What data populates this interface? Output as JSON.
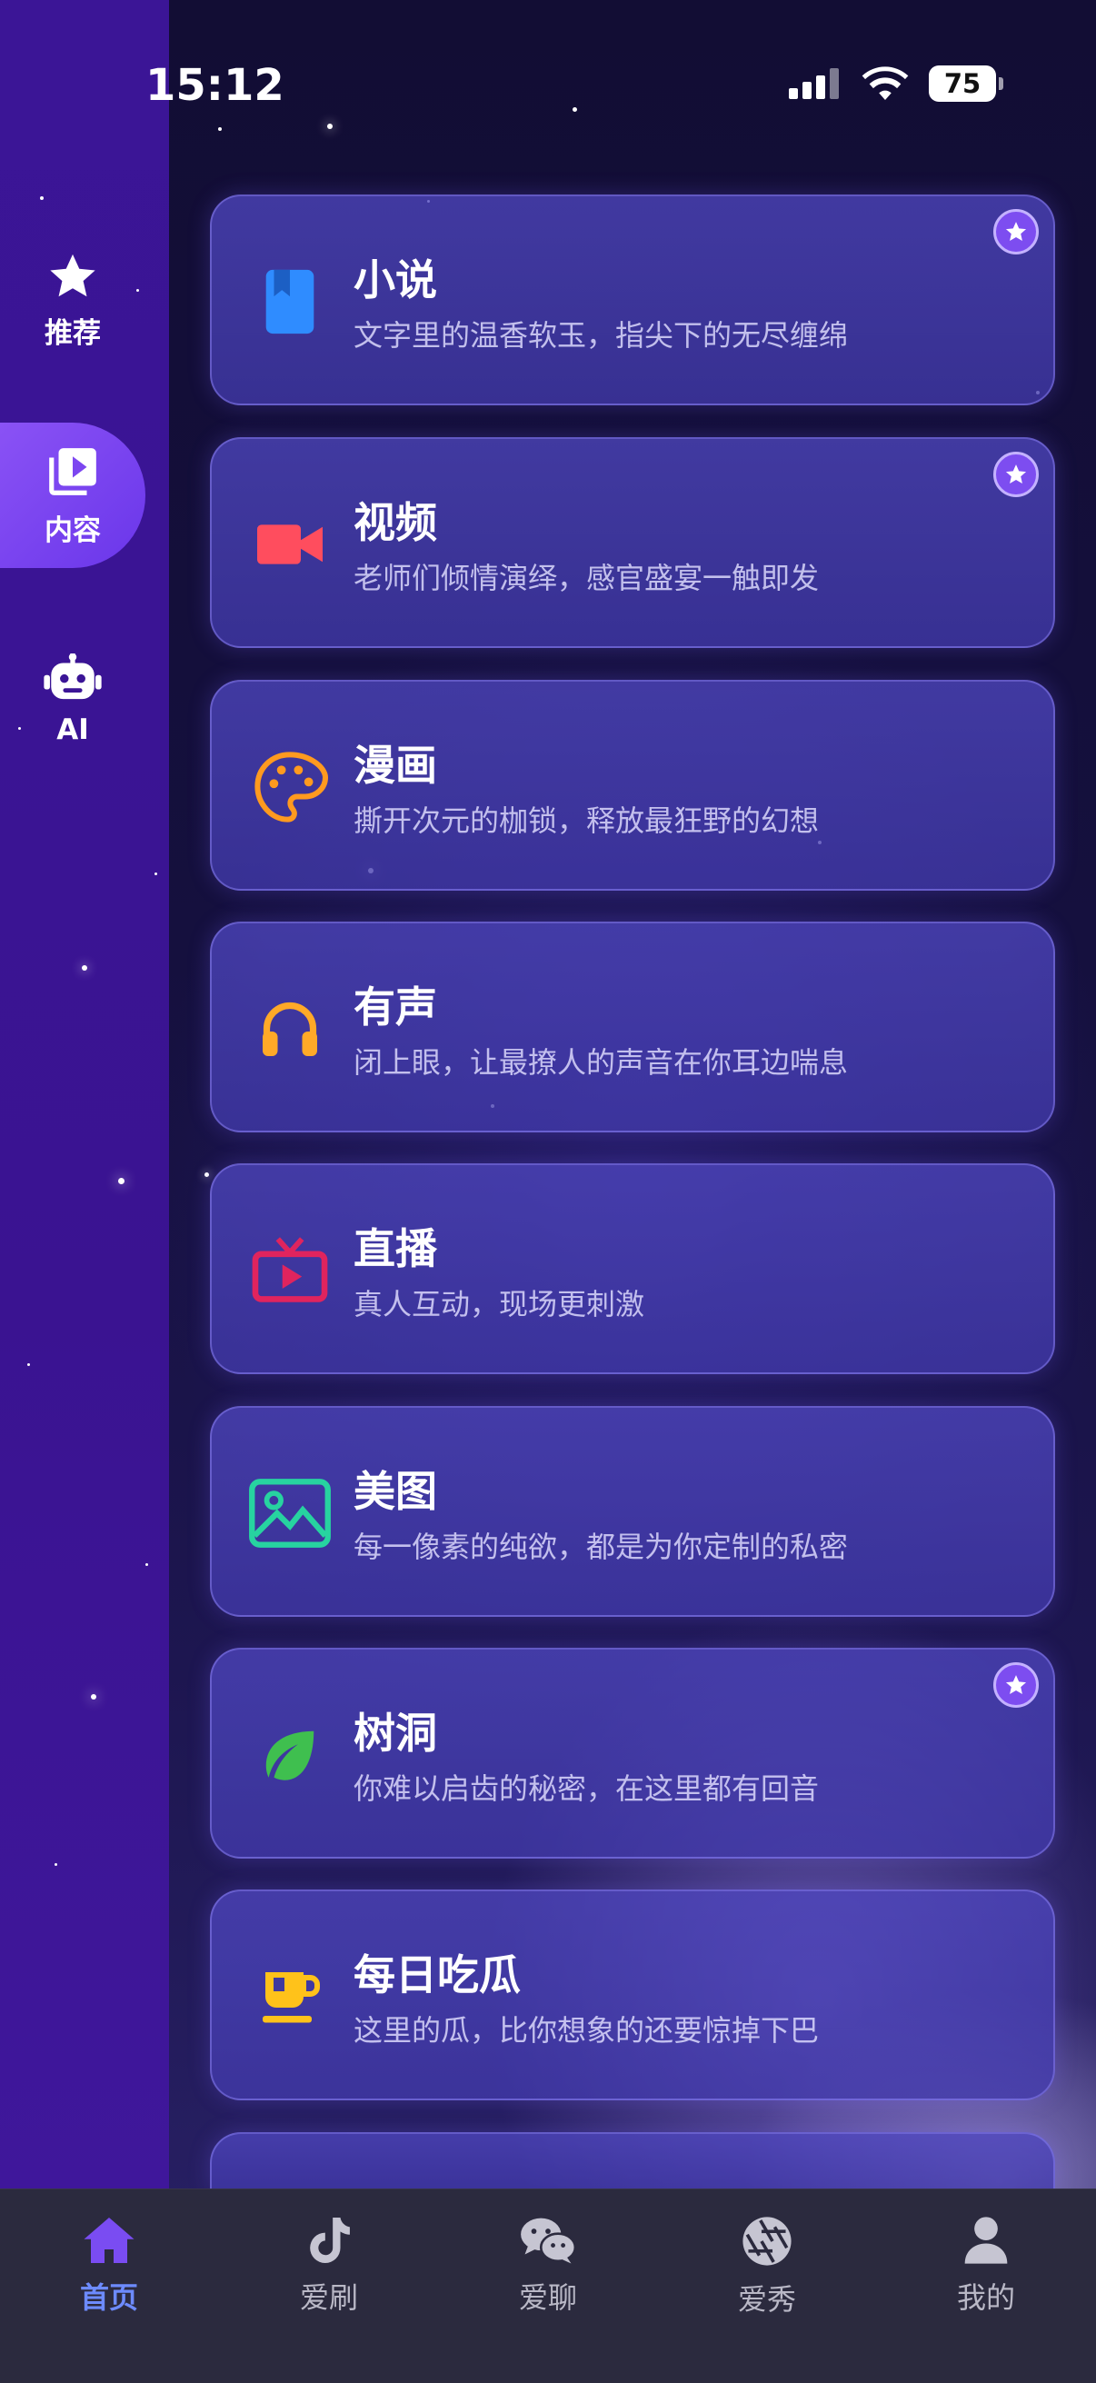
{
  "status_bar": {
    "time": "15:12",
    "battery": "75"
  },
  "sidebar": {
    "items": [
      {
        "label": "推荐",
        "icon": "star-icon",
        "active": false
      },
      {
        "label": "内容",
        "icon": "video-library-icon",
        "active": true
      },
      {
        "label": "AI",
        "icon": "robot-icon",
        "active": false
      }
    ]
  },
  "cards": [
    {
      "title": "小说",
      "desc": "文字里的温香软玉，指尖下的无尽缠绵",
      "icon": "book-icon",
      "icon_color": "#2f8cff",
      "badge": true
    },
    {
      "title": "视频",
      "desc": "老师们倾情演绎，感官盛宴一触即发",
      "icon": "video-camera-icon",
      "icon_color": "#ff4d5e",
      "badge": true
    },
    {
      "title": "漫画",
      "desc": "撕开次元的枷锁，释放最狂野的幻想",
      "icon": "palette-icon",
      "icon_color": "#ff9a1f",
      "badge": false
    },
    {
      "title": "有声",
      "desc": "闭上眼，让最撩人的声音在你耳边喘息",
      "icon": "headphones-icon",
      "icon_color": "#ffa928",
      "badge": false
    },
    {
      "title": "直播",
      "desc": "真人互动，现场更刺激",
      "icon": "live-tv-icon",
      "icon_color": "#e0245e",
      "badge": false
    },
    {
      "title": "美图",
      "desc": "每一像素的纯欲，都是为你定制的私密",
      "icon": "image-icon",
      "icon_color": "#27d3a0",
      "badge": false
    },
    {
      "title": "树洞",
      "desc": "你难以启齿的秘密，在这里都有回音",
      "icon": "leaf-icon",
      "icon_color": "#3fbf4f",
      "badge": true
    },
    {
      "title": "每日吃瓜",
      "desc": "这里的瓜，比你想象的还要惊掉下巴",
      "icon": "coffee-cup-icon",
      "icon_color": "#ffc21a",
      "badge": false
    }
  ],
  "tabbar": {
    "items": [
      {
        "label": "首页",
        "icon": "home-icon",
        "active": true
      },
      {
        "label": "爱刷",
        "icon": "tiktok-icon",
        "active": false
      },
      {
        "label": "爱聊",
        "icon": "wechat-icon",
        "active": false
      },
      {
        "label": "爱秀",
        "icon": "aperture-icon",
        "active": false
      },
      {
        "label": "我的",
        "icon": "person-icon",
        "active": false
      }
    ]
  },
  "colors": {
    "accent": "#7d4df0",
    "tab_active": "#6d8bff",
    "sidebar": "#3b1596"
  }
}
